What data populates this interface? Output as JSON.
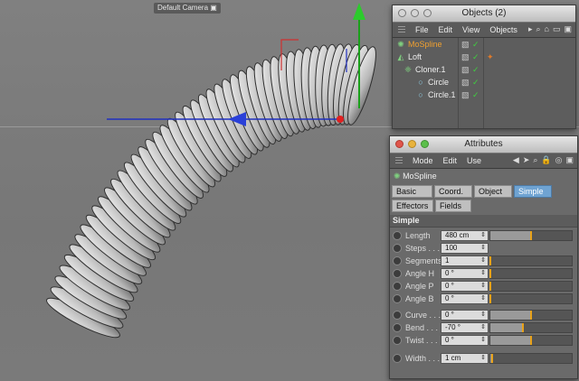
{
  "viewport": {
    "camera_label": "Default Camera"
  },
  "objects_window": {
    "title": "Objects (2)",
    "menu": [
      "File",
      "Edit",
      "View",
      "Objects"
    ],
    "items": [
      {
        "label": "MoSpline",
        "icon": "mospline-icon"
      },
      {
        "label": "Loft",
        "icon": "loft-icon"
      },
      {
        "label": "Cloner.1",
        "icon": "cloner-icon"
      },
      {
        "label": "Circle",
        "icon": "circle-icon"
      },
      {
        "label": "Circle.1",
        "icon": "circle-icon"
      }
    ]
  },
  "attributes_window": {
    "title": "Attributes",
    "menu": [
      "Mode",
      "Edit",
      "Use"
    ],
    "object_name": "MoSpline",
    "tabs": [
      "Basic",
      "Coord.",
      "Object",
      "Simple",
      "Effectors",
      "Fields"
    ],
    "active_tab": "Simple",
    "section": "Simple",
    "params": [
      {
        "label": "Length",
        "value": "480 cm",
        "slider": 0.5
      },
      {
        "label": "Steps . . . .",
        "value": "100"
      },
      {
        "label": "Segments",
        "value": "1",
        "slider": 0.0
      },
      {
        "label": "Angle H",
        "value": "0 °",
        "slider": 0.0
      },
      {
        "label": "Angle P",
        "value": "0 °",
        "slider": 0.0
      },
      {
        "label": "Angle B",
        "value": "0 °",
        "slider": 0.0
      },
      {
        "label": "Curve . . .",
        "value": "0 °",
        "slider": 0.5
      },
      {
        "label": "Bend . . . .",
        "value": "-70 °",
        "slider": 0.4
      },
      {
        "label": "Twist . . .",
        "value": "0 °",
        "slider": 0.5
      },
      {
        "label": "Width . . .",
        "value": "1 cm",
        "slider": 0.02
      }
    ]
  },
  "colors": {
    "active_tab": "#6fa3d2",
    "selected_object": "#f0a030",
    "accent_slider": "#e8a21a"
  }
}
